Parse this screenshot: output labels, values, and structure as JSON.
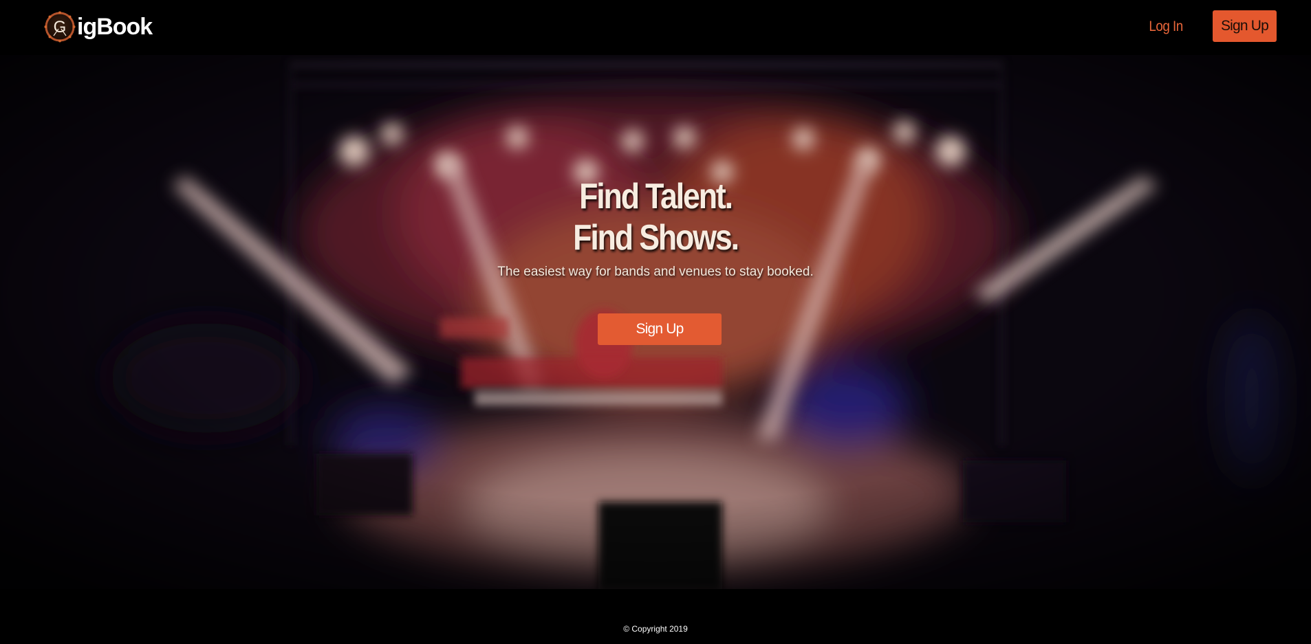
{
  "header": {
    "brand_text": "igBook",
    "brand_logo_letter": "G",
    "login_label": "Log In",
    "signup_label": "Sign Up"
  },
  "hero": {
    "title_line1": "Find Talent.",
    "title_line2": "Find Shows.",
    "subtitle": "The easiest way for bands and venues to stay booked.",
    "signup_label": "Sign Up",
    "background_icon": "concert-stage-image"
  },
  "footer": {
    "copyright": "© Copyright 2019"
  },
  "colors": {
    "accent": "#e4582e",
    "accent_text": "#e8663a",
    "background": "#000000",
    "hero_text": "#f7ece0"
  },
  "icons": {
    "logo": "guitar-pick-logo-icon"
  }
}
